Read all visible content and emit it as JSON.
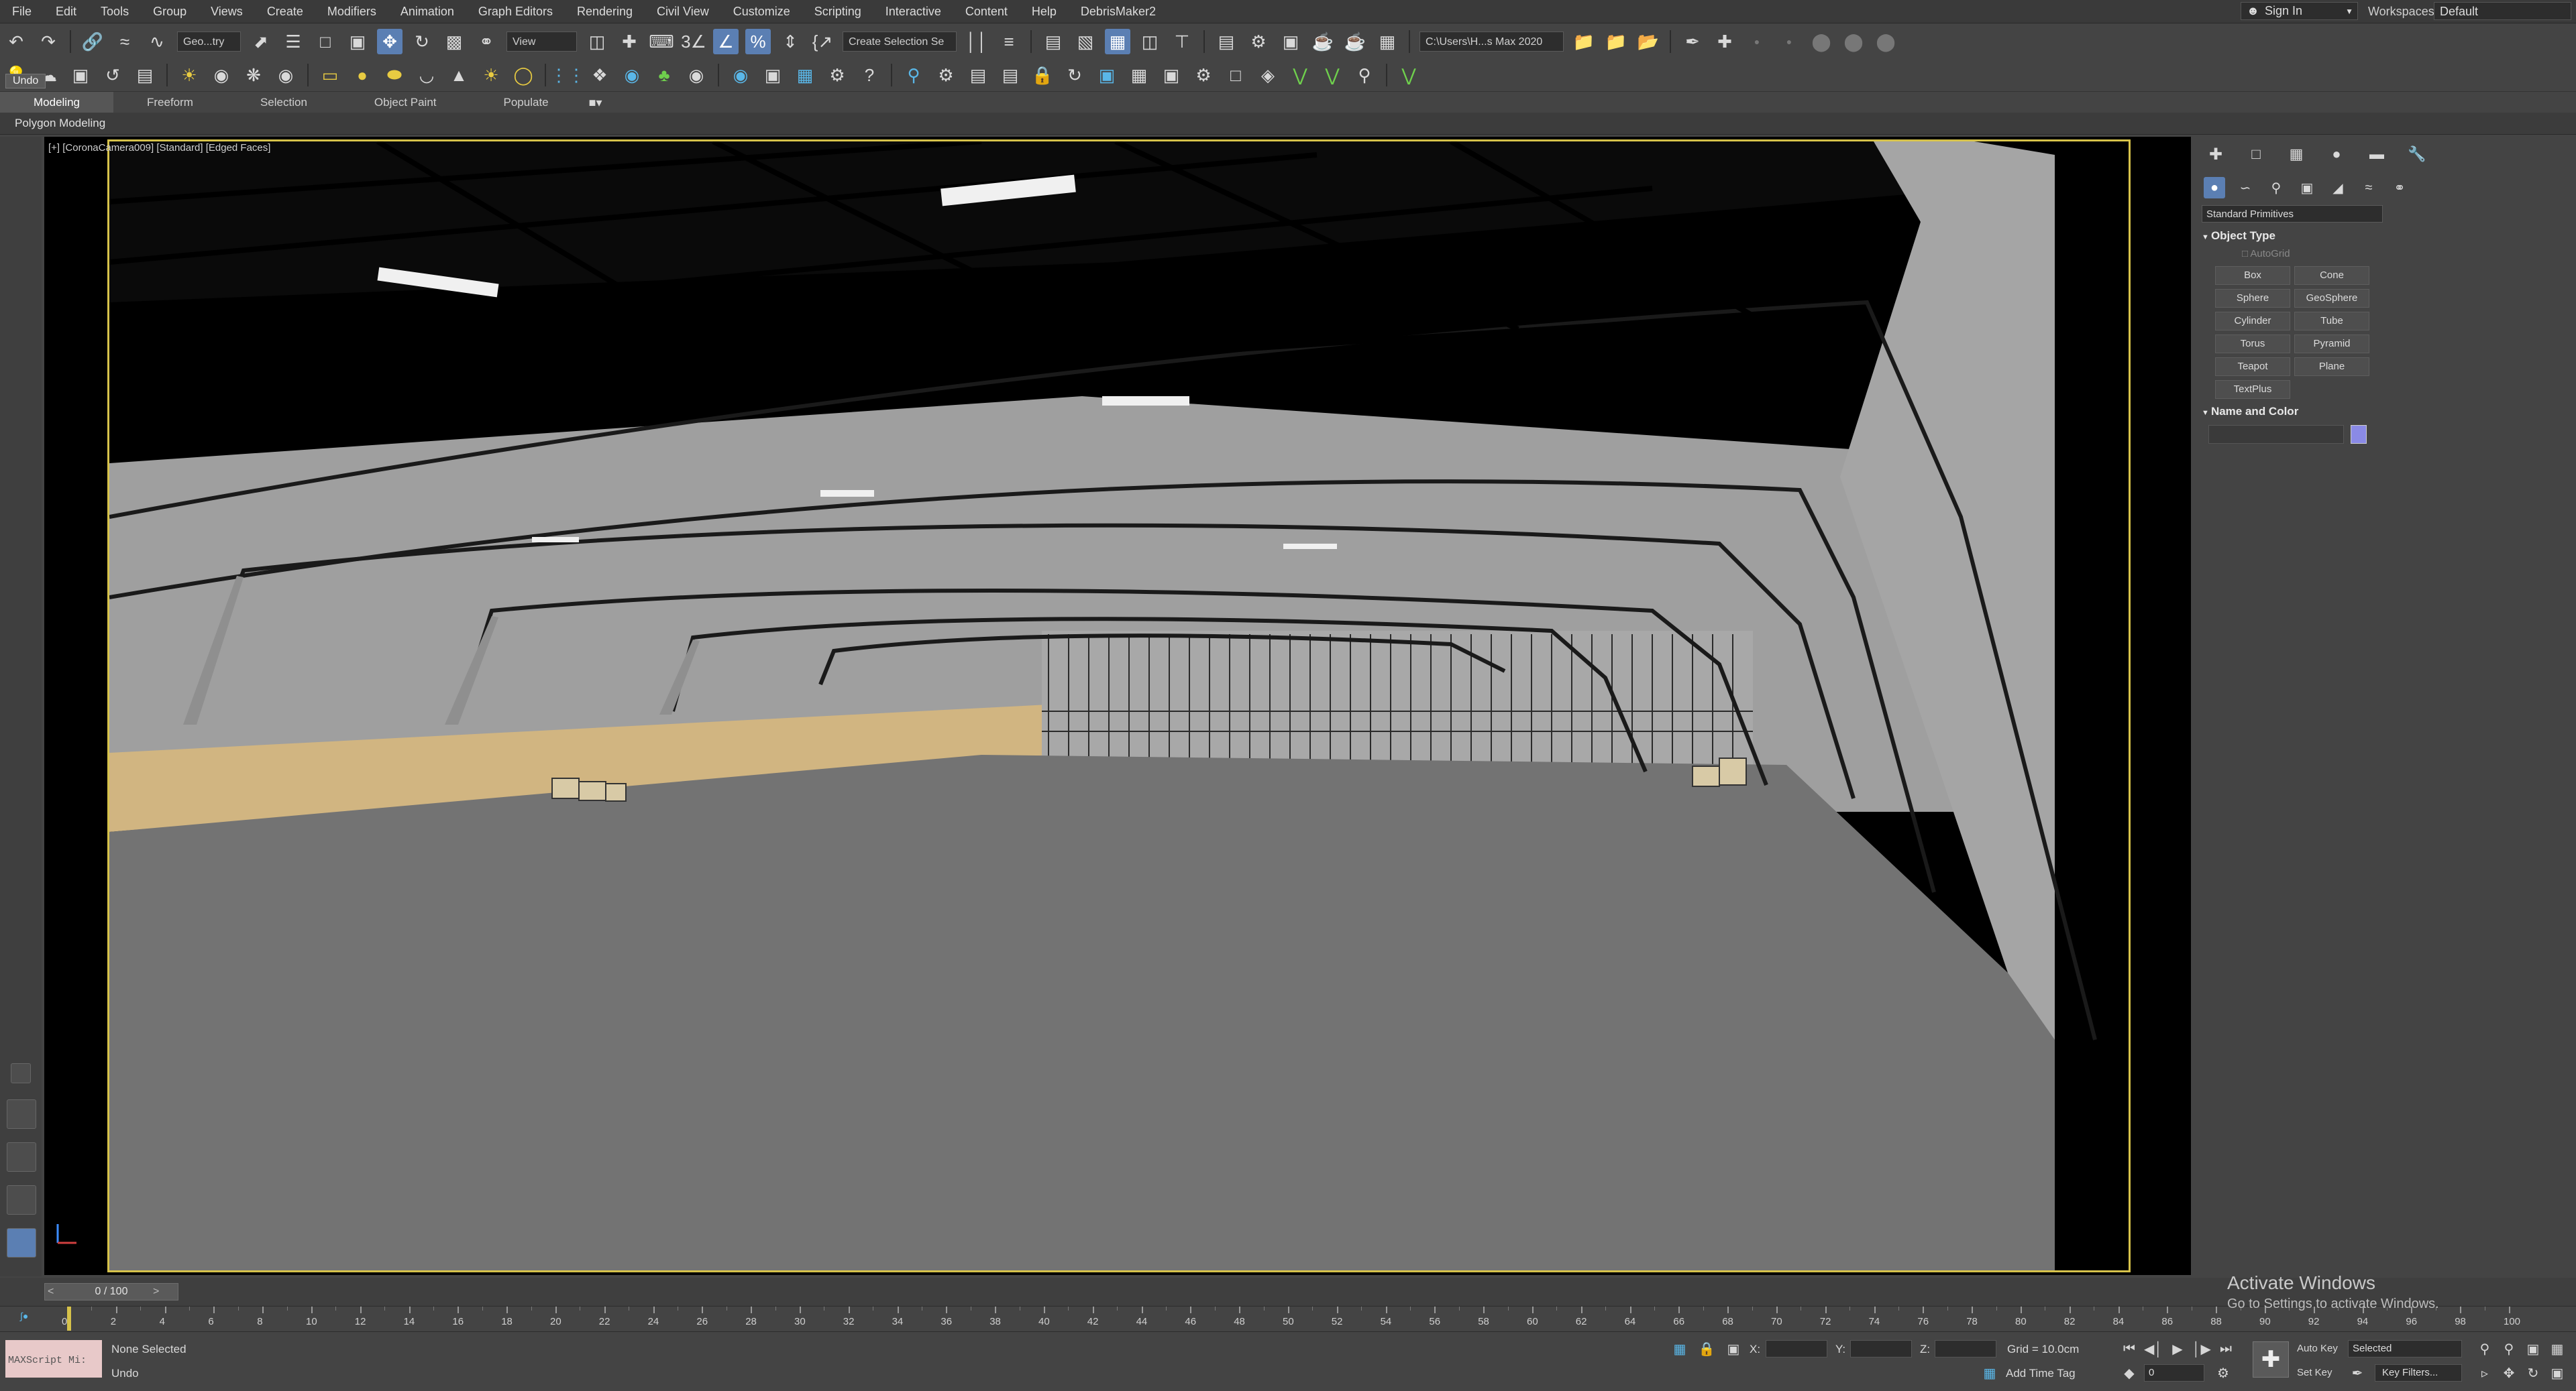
{
  "menu": [
    "File",
    "Edit",
    "Tools",
    "Group",
    "Views",
    "Create",
    "Modifiers",
    "Animation",
    "Graph Editors",
    "Rendering",
    "Civil View",
    "Customize",
    "Scripting",
    "Interactive",
    "Content",
    "Help",
    "DebrisMaker2"
  ],
  "account": {
    "sign_in": "Sign In",
    "workspaces_label": "Workspaces:",
    "workspace": "Default"
  },
  "toolbar": {
    "selection_filter": "Geo...try",
    "ref_coord": "View",
    "named_selection": "Create Selection Se",
    "project_path": "C:\\Users\\H...s Max 2020",
    "undo_tooltip": "Undo"
  },
  "ribbon": {
    "tabs": [
      "Modeling",
      "Freeform",
      "Selection",
      "Object Paint",
      "Populate"
    ],
    "panel_label": "Polygon Modeling"
  },
  "viewport": {
    "label": "[+] [CoronaCamera009] [Standard] [Edged Faces]"
  },
  "command_panel": {
    "category": "Standard Primitives",
    "object_type_title": "Object Type",
    "autogrid": "AutoGrid",
    "buttons": [
      "Box",
      "Cone",
      "Sphere",
      "GeoSphere",
      "Cylinder",
      "Tube",
      "Torus",
      "Pyramid",
      "Teapot",
      "Plane",
      "TextPlus"
    ],
    "name_color_title": "Name and Color",
    "color": "#8a8ae6"
  },
  "timeline": {
    "frame_display": "0 / 100",
    "ticks": [
      "0",
      "2",
      "4",
      "6",
      "8",
      "10",
      "12",
      "14",
      "16",
      "18",
      "20",
      "22",
      "24",
      "26",
      "28",
      "30",
      "32",
      "34",
      "36",
      "38",
      "40",
      "42",
      "44",
      "46",
      "48",
      "50",
      "52",
      "54",
      "56",
      "58",
      "60",
      "62",
      "64",
      "66",
      "68",
      "70",
      "72",
      "74",
      "76",
      "78",
      "80",
      "82",
      "84",
      "86",
      "88",
      "90",
      "92",
      "94",
      "96",
      "98",
      "100"
    ]
  },
  "status": {
    "maxscript": "MAXScript Mi:",
    "selection": "None Selected",
    "prompt": "Undo",
    "x_label": "X:",
    "y_label": "Y:",
    "z_label": "Z:",
    "grid": "Grid = 10.0cm",
    "add_time_tag": "Add Time Tag",
    "auto_key": "Auto Key",
    "set_key": "Set Key",
    "key_mode": "Selected",
    "key_filters": "Key Filters...",
    "frame": "0"
  },
  "watermark": {
    "title": "Activate Windows",
    "subtitle": "Go to Settings to activate Windows."
  }
}
